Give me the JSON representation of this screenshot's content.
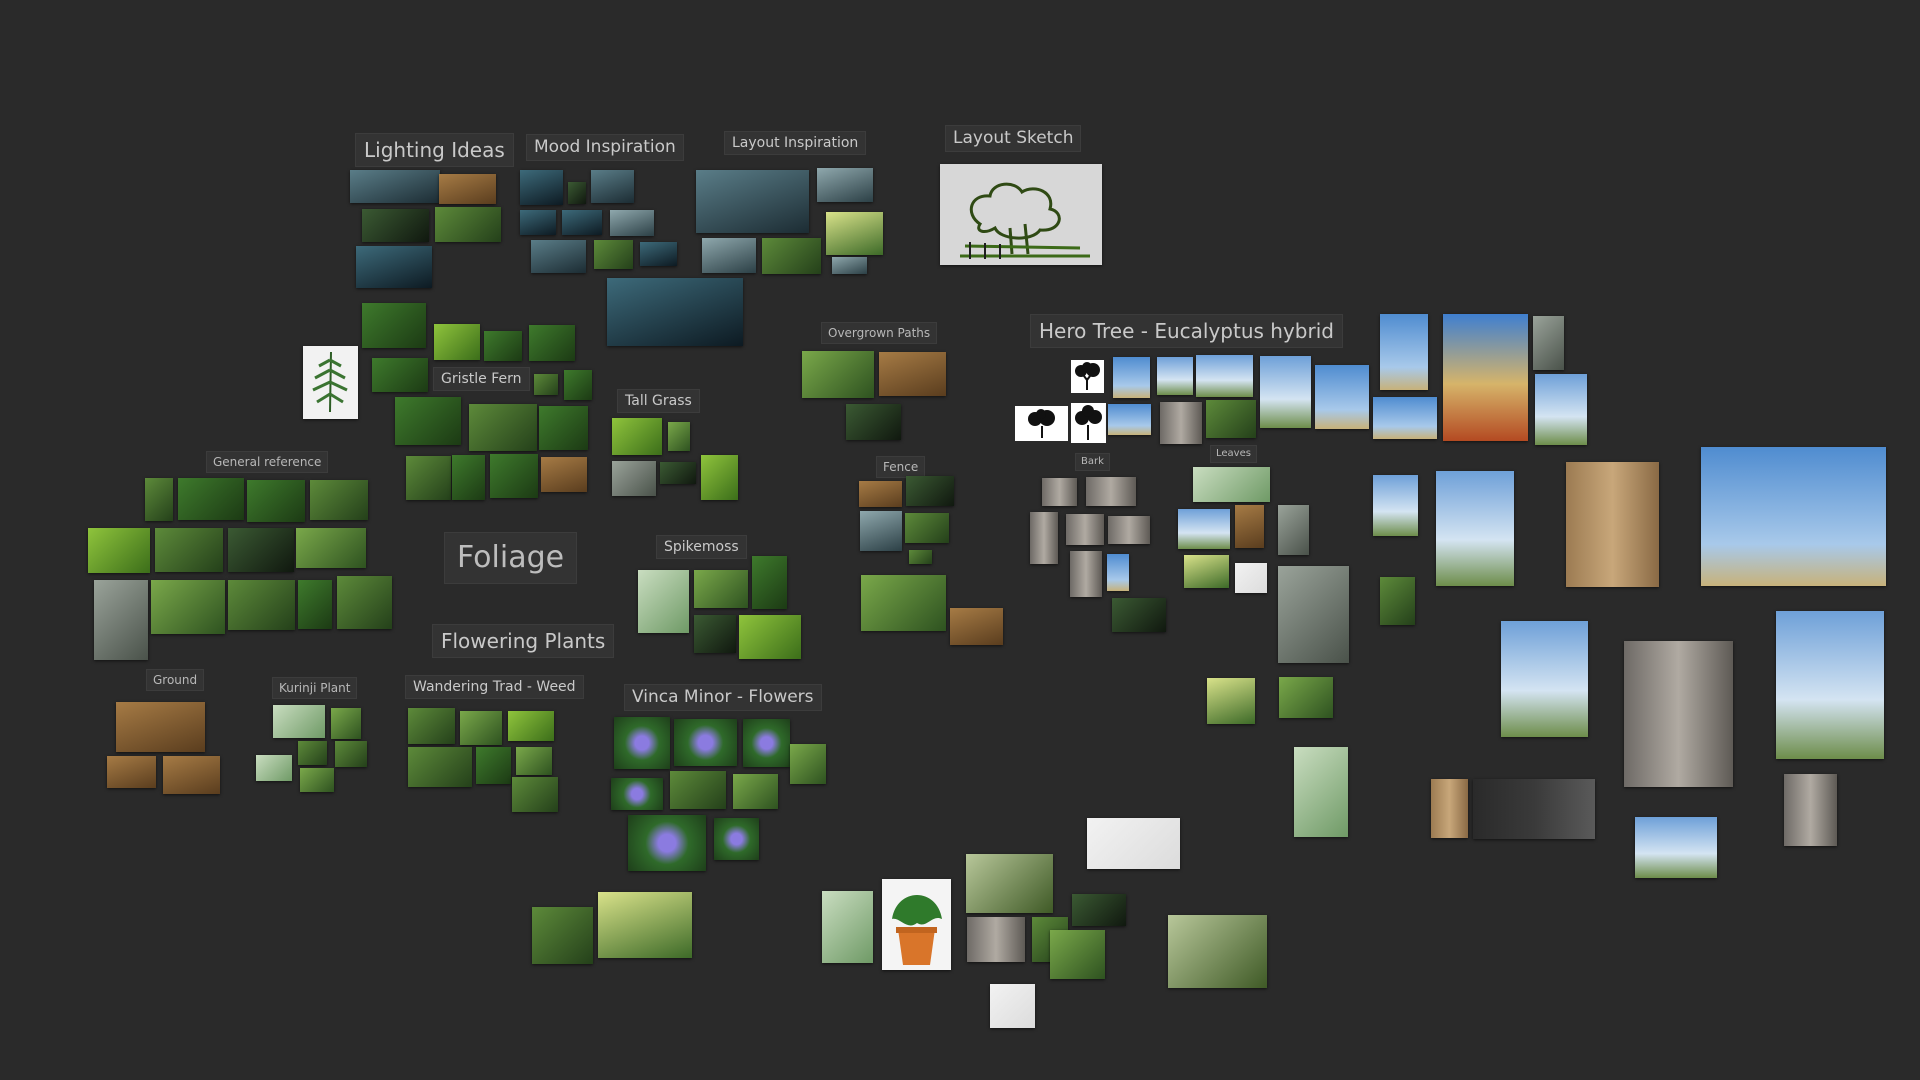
{
  "board": {
    "background": "#2a2a2a",
    "groups": [
      {
        "id": "foliage",
        "title": "Foliage"
      },
      {
        "id": "lighting",
        "title": "Lighting Ideas"
      },
      {
        "id": "mood",
        "title": "Mood Inspiration"
      },
      {
        "id": "layout_insp",
        "title": "Layout Inspiration"
      },
      {
        "id": "layout_sketch",
        "title": "Layout Sketch"
      },
      {
        "id": "hero_tree",
        "title": "Hero Tree - Eucalyptus hybrid"
      },
      {
        "id": "overgrown",
        "title": "Overgrown Paths"
      },
      {
        "id": "gristle",
        "title": "Gristle Fern"
      },
      {
        "id": "tall_grass",
        "title": "Tall Grass"
      },
      {
        "id": "general",
        "title": "General reference"
      },
      {
        "id": "fence",
        "title": "Fence"
      },
      {
        "id": "bark",
        "title": "Bark"
      },
      {
        "id": "leaves",
        "title": "Leaves"
      },
      {
        "id": "spikemoss",
        "title": "Spikemoss"
      },
      {
        "id": "flowering",
        "title": "Flowering Plants"
      },
      {
        "id": "ground",
        "title": "Ground"
      },
      {
        "id": "kurinji",
        "title": "Kurinji Plant"
      },
      {
        "id": "wandering",
        "title": "Wandering Trad - Weed"
      },
      {
        "id": "vinca",
        "title": "Vinca Minor - Flowers"
      }
    ]
  },
  "colors": {
    "label_bg": "#333333",
    "label_text": "#c9c9c9",
    "foliage_green": "#3d6b2a",
    "sky_blue": "#5f8fc4",
    "bark_brown": "#8a6a45",
    "vinca_purple": "#6a5ac8"
  }
}
